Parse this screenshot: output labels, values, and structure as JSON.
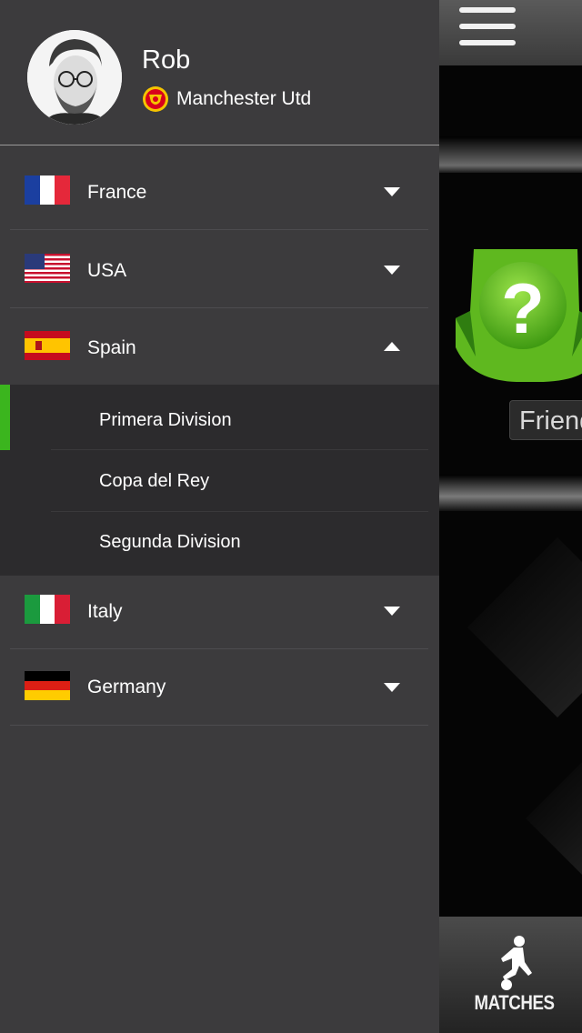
{
  "profile": {
    "name": "Rob",
    "club": "Manchester Utd"
  },
  "countries": [
    {
      "name": "France",
      "expanded": false
    },
    {
      "name": "USA",
      "expanded": false
    },
    {
      "name": "Spain",
      "expanded": true,
      "leagues": [
        {
          "name": "Primera Division",
          "active": true
        },
        {
          "name": "Copa del Rey",
          "active": false
        },
        {
          "name": "Segunda Division",
          "active": false
        }
      ]
    },
    {
      "name": "Italy",
      "expanded": false
    },
    {
      "name": "Germany",
      "expanded": false
    }
  ],
  "main": {
    "card_label": "Friends",
    "tab_label": "MATCHES"
  },
  "colors": {
    "drawer_bg": "#3c3b3d",
    "submenu_bg": "#2c2b2d",
    "active_accent": "#3bb51e"
  },
  "icons": [
    "menu-icon",
    "question-shield-icon",
    "player-kick-icon",
    "chevron-down-icon",
    "chevron-up-icon"
  ]
}
